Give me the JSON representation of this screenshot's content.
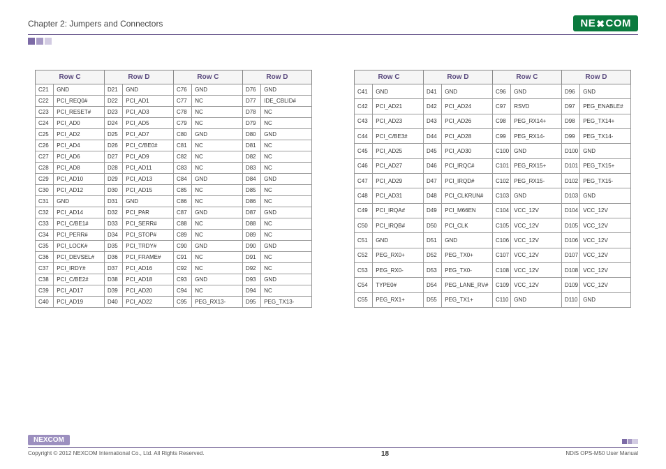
{
  "header": {
    "chapter": "Chapter 2: Jumpers and Connectors",
    "logo_text": "NE COM",
    "logo_x": "X"
  },
  "table_headers": [
    "Row C",
    "Row D",
    "Row C",
    "Row D"
  ],
  "table_left": [
    [
      "C21",
      "GND",
      "D21",
      "GND",
      "C76",
      "GND",
      "D76",
      "GND"
    ],
    [
      "C22",
      "PCI_REQ0#",
      "D22",
      "PCI_AD1",
      "C77",
      "NC",
      "D77",
      "IDE_CBLID#"
    ],
    [
      "C23",
      "PCI_RESET#",
      "D23",
      "PCI_AD3",
      "C78",
      "NC",
      "D78",
      "NC"
    ],
    [
      "C24",
      "PCI_AD0",
      "D24",
      "PCI_AD5",
      "C79",
      "NC",
      "D79",
      "NC"
    ],
    [
      "C25",
      "PCI_AD2",
      "D25",
      "PCI_AD7",
      "C80",
      "GND",
      "D80",
      "GND"
    ],
    [
      "C26",
      "PCI_AD4",
      "D26",
      "PCI_C/BE0#",
      "C81",
      "NC",
      "D81",
      "NC"
    ],
    [
      "C27",
      "PCI_AD6",
      "D27",
      "PCI_AD9",
      "C82",
      "NC",
      "D82",
      "NC"
    ],
    [
      "C28",
      "PCI_AD8",
      "D28",
      "PCI_AD11",
      "C83",
      "NC",
      "D83",
      "NC"
    ],
    [
      "C29",
      "PCI_AD10",
      "D29",
      "PCI_AD13",
      "C84",
      "GND",
      "D84",
      "GND"
    ],
    [
      "C30",
      "PCI_AD12",
      "D30",
      "PCI_AD15",
      "C85",
      "NC",
      "D85",
      "NC"
    ],
    [
      "C31",
      "GND",
      "D31",
      "GND",
      "C86",
      "NC",
      "D86",
      "NC"
    ],
    [
      "C32",
      "PCI_AD14",
      "D32",
      "PCI_PAR",
      "C87",
      "GND",
      "D87",
      "GND"
    ],
    [
      "C33",
      "PCI_C/BE1#",
      "D33",
      "PCI_SERR#",
      "C88",
      "NC",
      "D88",
      "NC"
    ],
    [
      "C34",
      "PCI_PERR#",
      "D34",
      "PCI_STOP#",
      "C89",
      "NC",
      "D89",
      "NC"
    ],
    [
      "C35",
      "PCI_LOCK#",
      "D35",
      "PCI_TRDY#",
      "C90",
      "GND",
      "D90",
      "GND"
    ],
    [
      "C36",
      "PCI_DEVSEL#",
      "D36",
      "PCI_FRAME#",
      "C91",
      "NC",
      "D91",
      "NC"
    ],
    [
      "C37",
      "PCI_IRDY#",
      "D37",
      "PCI_AD16",
      "C92",
      "NC",
      "D92",
      "NC"
    ],
    [
      "C38",
      "PCI_C/BE2#",
      "D38",
      "PCI_AD18",
      "C93",
      "GND",
      "D93",
      "GND"
    ],
    [
      "C39",
      "PCI_AD17",
      "D39",
      "PCI_AD20",
      "C94",
      "NC",
      "D94",
      "NC"
    ],
    [
      "C40",
      "PCI_AD19",
      "D40",
      "PCI_AD22",
      "C95",
      "PEG_RX13-",
      "D95",
      "PEG_TX13-"
    ]
  ],
  "table_right": [
    [
      "C41",
      "GND",
      "D41",
      "GND",
      "C96",
      "GND",
      "D96",
      "GND"
    ],
    [
      "C42",
      "PCI_AD21",
      "D42",
      "PCI_AD24",
      "C97",
      "RSVD",
      "D97",
      "PEG_ENABLE#"
    ],
    [
      "C43",
      "PCI_AD23",
      "D43",
      "PCI_AD26",
      "C98",
      "PEG_RX14+",
      "D98",
      "PEG_TX14+"
    ],
    [
      "C44",
      "PCI_C/BE3#",
      "D44",
      "PCI_AD28",
      "C99",
      "PEG_RX14-",
      "D99",
      "PEG_TX14-"
    ],
    [
      "C45",
      "PCI_AD25",
      "D45",
      "PCI_AD30",
      "C100",
      "GND",
      "D100",
      "GND"
    ],
    [
      "C46",
      "PCI_AD27",
      "D46",
      "PCI_IRQC#",
      "C101",
      "PEG_RX15+",
      "D101",
      "PEG_TX15+"
    ],
    [
      "C47",
      "PCI_AD29",
      "D47",
      "PCI_IRQD#",
      "C102",
      "PEG_RX15-",
      "D102",
      "PEG_TX15-"
    ],
    [
      "C48",
      "PCI_AD31",
      "D48",
      "PCI_CLKRUN#",
      "C103",
      "GND",
      "D103",
      "GND"
    ],
    [
      "C49",
      "PCI_IRQA#",
      "D49",
      "PCI_M66EN",
      "C104",
      "VCC_12V",
      "D104",
      "VCC_12V"
    ],
    [
      "C50",
      "PCI_IRQB#",
      "D50",
      "PCI_CLK",
      "C105",
      "VCC_12V",
      "D105",
      "VCC_12V"
    ],
    [
      "C51",
      "GND",
      "D51",
      "GND",
      "C106",
      "VCC_12V",
      "D106",
      "VCC_12V"
    ],
    [
      "C52",
      "PEG_RX0+",
      "D52",
      "PEG_TX0+",
      "C107",
      "VCC_12V",
      "D107",
      "VCC_12V"
    ],
    [
      "C53",
      "PEG_RX0-",
      "D53",
      "PEG_TX0-",
      "C108",
      "VCC_12V",
      "D108",
      "VCC_12V"
    ],
    [
      "C54",
      "TYPE0#",
      "D54",
      "PEG_LANE_RV#",
      "C109",
      "VCC_12V",
      "D109",
      "VCC_12V"
    ],
    [
      "C55",
      "PEG_RX1+",
      "D55",
      "PEG_TX1+",
      "C110",
      "GND",
      "D110",
      "GND"
    ]
  ],
  "footer": {
    "logo": "NEXCOM",
    "copyright": "Copyright © 2012 NEXCOM International Co., Ltd. All Rights Reserved.",
    "page": "18",
    "manual": "NDiS OPS-M50 User Manual"
  }
}
